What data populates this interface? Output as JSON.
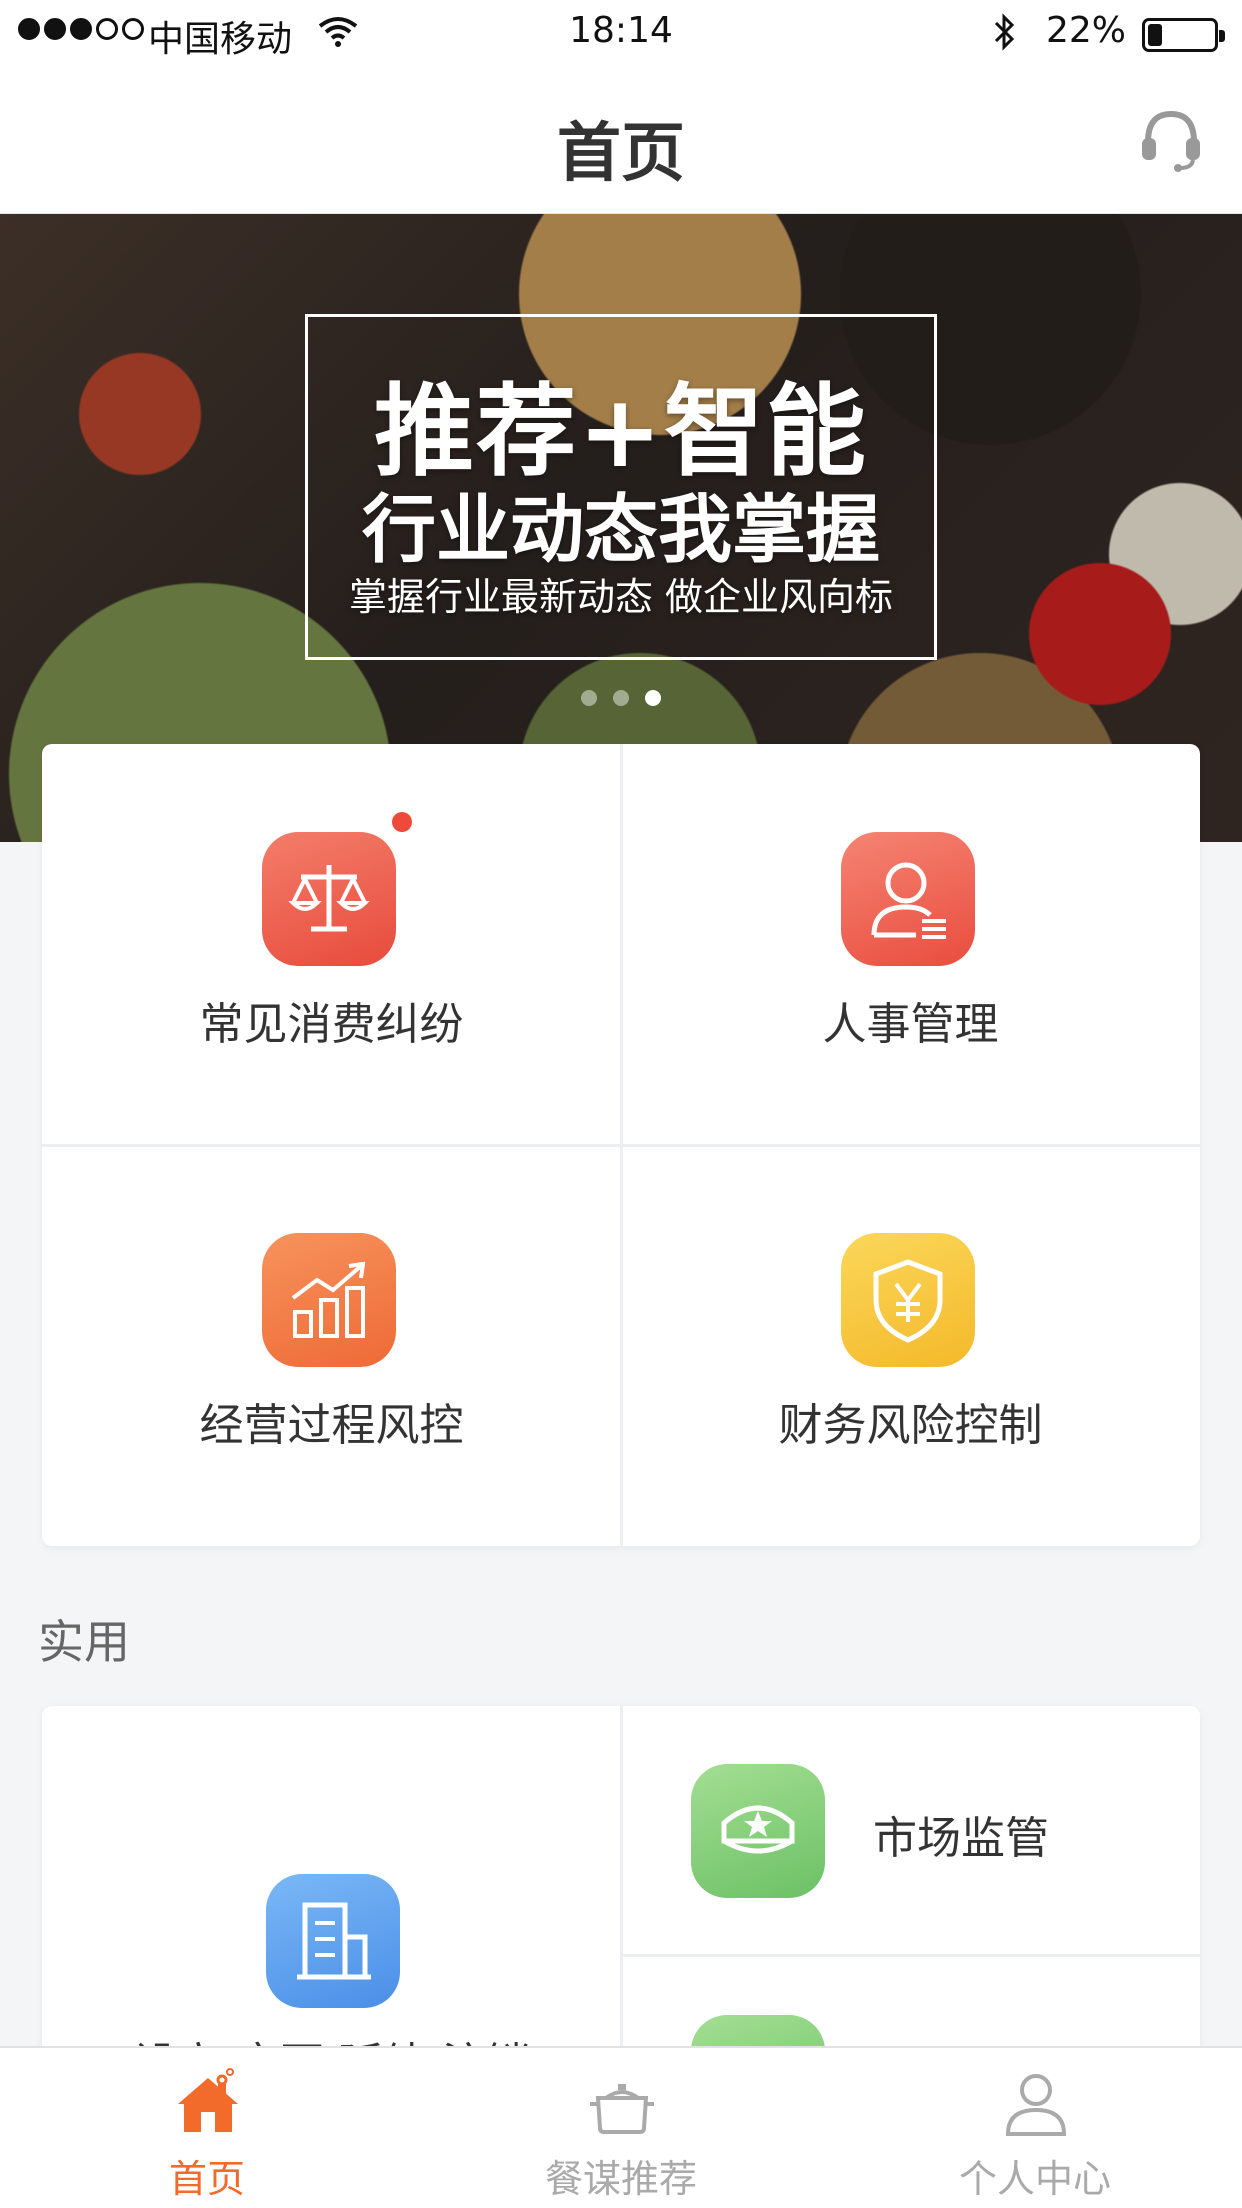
{
  "status_bar": {
    "carrier": "中国移动",
    "time": "18:14",
    "battery_percent": "22%",
    "battery_level": 0.22,
    "signal_bars_filled": 3,
    "signal_bars_total": 5
  },
  "nav": {
    "title": "首页",
    "right_icon": "headset-icon"
  },
  "banner": {
    "headline": "推荐+智能",
    "subheadline": "行业动态我掌握",
    "tagline": "掌握行业最新动态 做企业风向标",
    "page_count": 3,
    "active_page": 3
  },
  "grid": {
    "items": [
      {
        "label": "常见消费纠纷",
        "icon": "scales-icon",
        "color": "#ee5b4a",
        "has_badge": true
      },
      {
        "label": "人事管理",
        "icon": "person-icon",
        "color": "#ef5f4f"
      },
      {
        "label": "经营过程风控",
        "icon": "bar-chart-icon",
        "color": "#f27a45"
      },
      {
        "label": "财务风险控制",
        "icon": "shield-yen-icon",
        "color": "#f7c640"
      }
    ]
  },
  "section": {
    "title": "实用"
  },
  "utilities": {
    "left": {
      "label": "设立/变更/延续/注销",
      "icon": "building-icon",
      "color": "#5b9cec"
    },
    "right_top": {
      "label": "市场监管",
      "icon": "officer-cap-icon",
      "color": "#7ccc72"
    },
    "right_bottom": {
      "icon": "document-icon",
      "color": "#7ccc72"
    }
  },
  "tabbar": {
    "items": [
      {
        "label": "首页",
        "icon": "home-icon",
        "active": true
      },
      {
        "label": "餐谋推荐",
        "icon": "cooking-pot-icon",
        "active": false
      },
      {
        "label": "个人中心",
        "icon": "user-icon",
        "active": false
      }
    ]
  },
  "colors": {
    "accent": "#f26b2b",
    "background": "#f4f5f7",
    "divider": "#eceff2"
  }
}
